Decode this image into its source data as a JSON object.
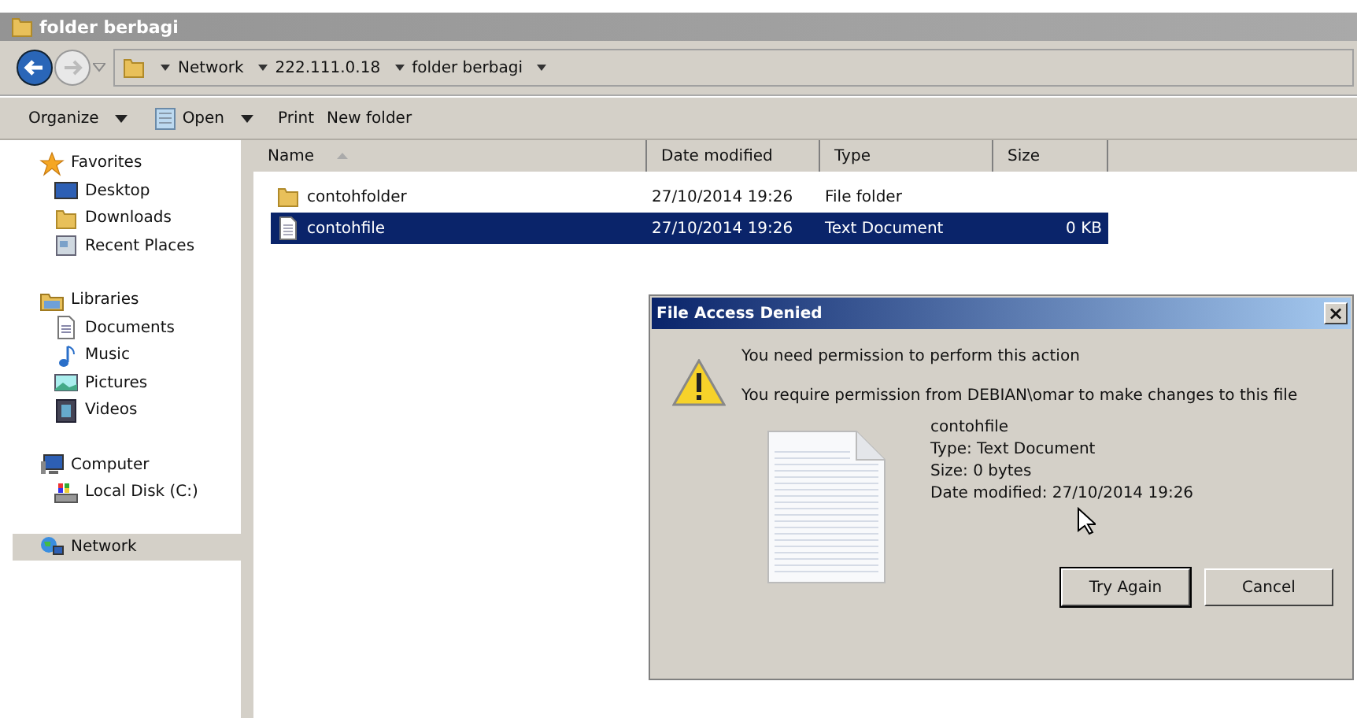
{
  "window": {
    "title": "folder berbagi"
  },
  "address": {
    "crumbs": [
      "Network",
      "222.111.0.18",
      "folder berbagi"
    ]
  },
  "toolbar": [
    {
      "label": "Organize",
      "kind": "menu"
    },
    {
      "label": "Open",
      "kind": "open"
    },
    {
      "label": "Print",
      "kind": "command"
    },
    {
      "label": "New folder",
      "kind": "command"
    }
  ],
  "sidebar": {
    "items": [
      {
        "label": "Favorites",
        "kind": "star",
        "selected": false,
        "children": [
          {
            "label": "Desktop",
            "kind": "desktop",
            "selected": false
          },
          {
            "label": "Downloads",
            "kind": "folder",
            "selected": false
          },
          {
            "label": "Recent Places",
            "kind": "recent",
            "selected": false
          }
        ]
      },
      {
        "label": "Libraries",
        "kind": "library",
        "selected": false,
        "children": [
          {
            "label": "Documents",
            "kind": "document",
            "selected": false
          },
          {
            "label": "Music",
            "kind": "music",
            "selected": false
          },
          {
            "label": "Pictures",
            "kind": "pictures",
            "selected": false
          },
          {
            "label": "Videos",
            "kind": "videos",
            "selected": false
          }
        ]
      },
      {
        "label": "Computer",
        "kind": "computer",
        "selected": false,
        "children": [
          {
            "label": "Local Disk (C:)",
            "kind": "disk",
            "selected": false
          }
        ]
      },
      {
        "label": "Network",
        "kind": "network",
        "selected": true
      }
    ]
  },
  "table": {
    "columns": [
      "Name",
      "Date modified",
      "Type",
      "Size"
    ],
    "rows": [
      {
        "name": "contohfolder",
        "date": "27/10/2014 19:26",
        "type": "File folder",
        "kind": "folder",
        "selected": false
      },
      {
        "name": "contohfile",
        "date": "27/10/2014 19:26",
        "type": "Text Document",
        "size": "0 KB",
        "kind": "file",
        "selected": true
      }
    ]
  },
  "dialog": {
    "title": "File Access Denied",
    "close": "×",
    "heading": "You need permission to perform this action",
    "message": "You require permission from DEBIAN\\omar to make changes to this file",
    "details": [
      "contohfile",
      "Type: Text Document",
      "Size: 0 bytes",
      "Date modified: 27/10/2014 19:26"
    ],
    "buttons": [
      {
        "label": "Try Again",
        "selected": true
      },
      {
        "label": "Cancel",
        "selected": false
      }
    ]
  }
}
